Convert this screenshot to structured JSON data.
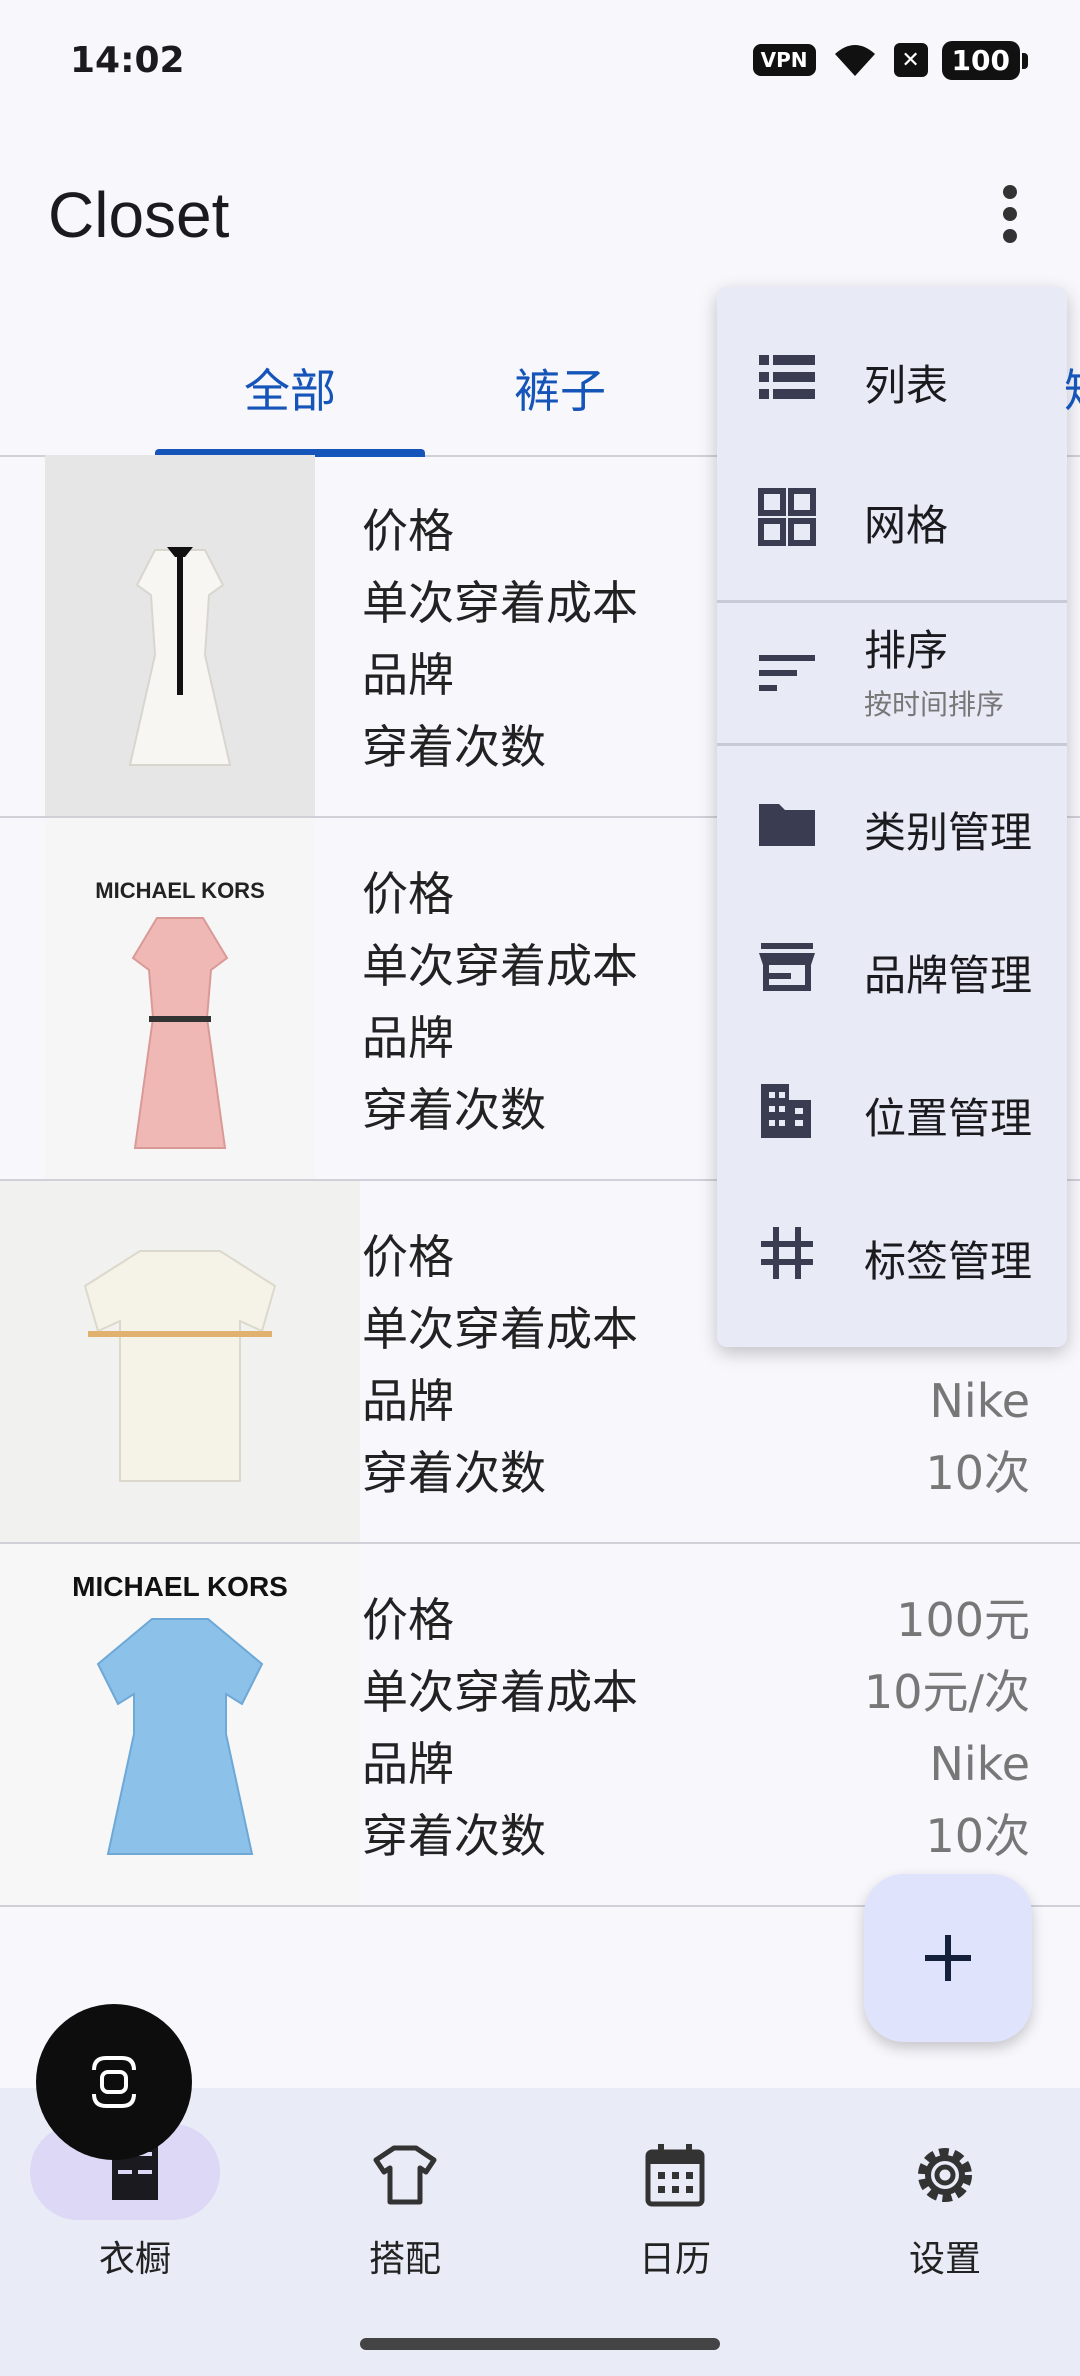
{
  "status_bar": {
    "time": "14:02",
    "vpn": "VPN",
    "battery": "100",
    "icons": [
      "vpn-icon",
      "wifi-icon",
      "x-icon",
      "battery-icon"
    ]
  },
  "app_bar": {
    "title": "Closet",
    "more_icon": "more-vert-icon"
  },
  "tabs": [
    {
      "label": "全部",
      "active": true
    },
    {
      "label": "裤子",
      "active": false
    }
  ],
  "peek_tab_text": "短",
  "items": [
    {
      "labels": [
        "价格",
        "单次穿着成本",
        "品牌",
        "穿着次数"
      ],
      "values": [
        "",
        "",
        "",
        ""
      ],
      "thumb": "white-dress"
    },
    {
      "labels": [
        "价格",
        "单次穿着成本",
        "品牌",
        "穿着次数"
      ],
      "values": [
        "",
        "",
        "",
        ""
      ],
      "thumb": "pink-dress",
      "brand_text": "MICHAEL KORS"
    },
    {
      "labels": [
        "价格",
        "单次穿着成本",
        "品牌",
        "穿着次数"
      ],
      "values": [
        "",
        "",
        "Nike",
        "10次"
      ],
      "thumb": "white-tshirt"
    },
    {
      "labels": [
        "价格",
        "单次穿着成本",
        "品牌",
        "穿着次数"
      ],
      "values": [
        "100元",
        "10元/次",
        "Nike",
        "10次"
      ],
      "thumb": "blue-dress",
      "brand_text": "MICHAEL KORS"
    }
  ],
  "menu": {
    "items": [
      {
        "label": "列表",
        "icon": "list-icon"
      },
      {
        "label": "网格",
        "icon": "grid-icon"
      },
      {
        "label": "排序",
        "sub": "按时间排序",
        "icon": "sort-icon"
      },
      {
        "label": "类别管理",
        "icon": "folder-icon"
      },
      {
        "label": "品牌管理",
        "icon": "store-icon"
      },
      {
        "label": "位置管理",
        "icon": "building-icon"
      },
      {
        "label": "标签管理",
        "icon": "hashtag-icon"
      }
    ]
  },
  "fab": {
    "icon": "plus-icon"
  },
  "bottom_nav": [
    {
      "label": "衣橱",
      "icon": "wardrobe-icon",
      "active": true
    },
    {
      "label": "搭配",
      "icon": "tshirt-icon",
      "active": false
    },
    {
      "label": "日历",
      "icon": "calendar-icon",
      "active": false
    },
    {
      "label": "设置",
      "icon": "gear-icon",
      "active": false
    }
  ],
  "colors": {
    "accent": "#1554b8",
    "menu_bg": "#e8eaf6",
    "nav_bg": "#e9ebf7",
    "fab_bg": "#dfe3fb"
  }
}
